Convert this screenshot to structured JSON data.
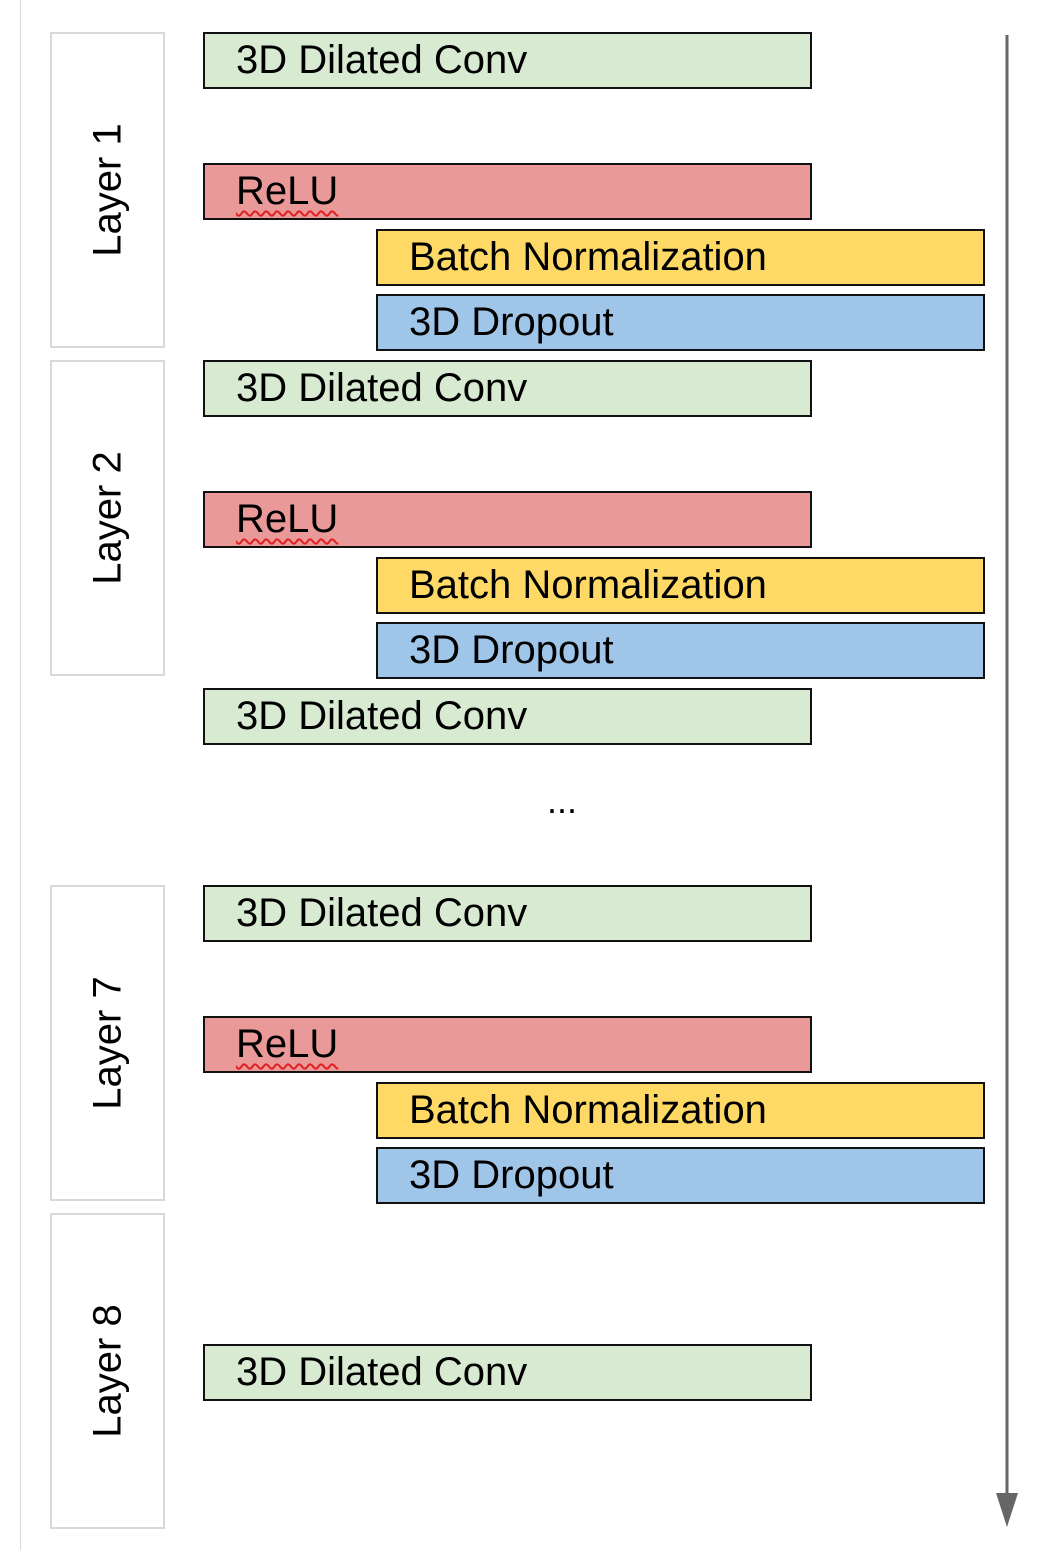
{
  "layers": [
    "Layer 1",
    "Layer 2",
    "Layer 7",
    "Layer 8"
  ],
  "blocks": {
    "conv": "3D Dilated Conv",
    "relu": "ReLU",
    "bn": "Batch Normalization",
    "dropout": "3D Dropout"
  },
  "ellipsis": "...",
  "colors": {
    "conv": "#d9ead3",
    "relu": "#ea9999",
    "bn": "#ffd966",
    "dropout": "#9fc5e8",
    "arrow": "#666666"
  },
  "arrow_direction": "down"
}
